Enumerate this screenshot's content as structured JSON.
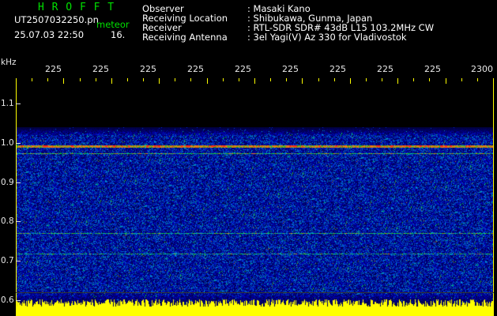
{
  "header": {
    "brand": "H R O F F T",
    "filename": "UT2507032250.pn",
    "mode": "meteor",
    "timestamp": "25.07.03 22:50",
    "index": "16.",
    "fields": [
      {
        "label": "Observer",
        "value": ": Masaki Kano"
      },
      {
        "label": "Receiving Location",
        "value": ": Shibukawa, Gunma, Japan"
      },
      {
        "label": "Receiver",
        "value": ": RTL-SDR SDR# 43dB L15 103.2MHz CW"
      },
      {
        "label": "Receiving Antenna",
        "value": ": 3el Yagi(V) Az 330 for Vladivostok"
      }
    ]
  },
  "plot": {
    "y_unit": "kHz",
    "y_ticks": [
      "1.1",
      "1.0",
      "0.9",
      "0.8",
      "0.7",
      "0.6"
    ],
    "x_ticks": [
      "225",
      "225",
      "225",
      "225",
      "225",
      "225",
      "225",
      "225",
      "225",
      "2300"
    ],
    "colors": {
      "accent": "#00e000",
      "tick": "#ffff00",
      "label": "#e8e8e8"
    }
  }
}
